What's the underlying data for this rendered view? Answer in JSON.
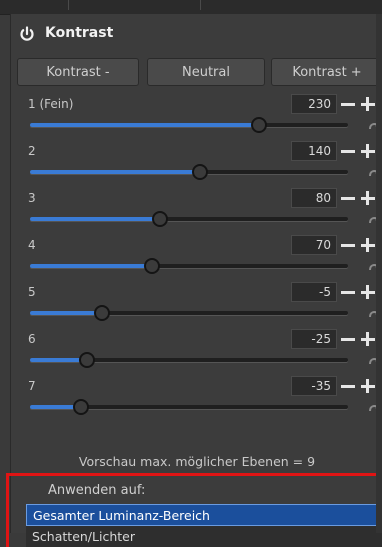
{
  "panel": {
    "title": "Kontrast",
    "buttons": {
      "decrease": "Kontrast -",
      "neutral": "Neutral",
      "increase": "Kontrast +"
    },
    "levels": [
      {
        "label": "1 (Fein)",
        "value": "230",
        "fraction": 0.72
      },
      {
        "label": "2",
        "value": "140",
        "fraction": 0.535
      },
      {
        "label": "3",
        "value": "80",
        "fraction": 0.41
      },
      {
        "label": "4",
        "value": "70",
        "fraction": 0.385
      },
      {
        "label": "5",
        "value": "-5",
        "fraction": 0.225
      },
      {
        "label": "6",
        "value": "-25",
        "fraction": 0.18
      },
      {
        "label": "7",
        "value": "-35",
        "fraction": 0.16
      }
    ],
    "preview_info": "Vorschau max. möglicher Ebenen = 9",
    "apply": {
      "label": "Anwenden auf:",
      "options": [
        "Gesamter Luminanz-Bereich",
        "Schatten/Lichter"
      ],
      "selected": "Gesamter Luminanz-Bereich"
    }
  },
  "colors": {
    "accent": "#3a7bd5",
    "highlight_border": "#e01414",
    "selection": "#1b4f9c"
  },
  "icons": [
    "power-icon",
    "minus-icon",
    "plus-icon",
    "reset-icon"
  ]
}
